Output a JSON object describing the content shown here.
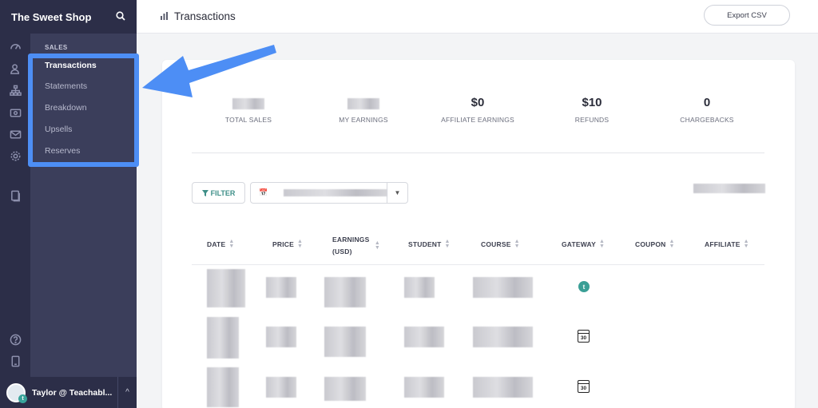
{
  "sidebar": {
    "brand": "The Sweet Shop",
    "section_label": "SALES",
    "items": [
      {
        "label": "Transactions",
        "active": true
      },
      {
        "label": "Statements",
        "active": false
      },
      {
        "label": "Breakdown",
        "active": false
      },
      {
        "label": "Upsells",
        "active": false
      },
      {
        "label": "Reserves",
        "active": false
      }
    ],
    "rail_icons": [
      "dashboard-icon",
      "users-icon",
      "sitemap-icon",
      "sales-icon",
      "email-icon",
      "settings-icon",
      "pages-icon",
      "help-icon",
      "mobile-icon"
    ],
    "user": {
      "name": "Taylor @ Teachabl...",
      "badge": "t"
    }
  },
  "header": {
    "title": "Transactions",
    "export_label": "Export CSV"
  },
  "stats": [
    {
      "value": "",
      "label": "TOTAL SALES",
      "blurred": true
    },
    {
      "value": "",
      "label": "MY EARNINGS",
      "blurred": true
    },
    {
      "value": "$0",
      "label": "AFFILIATE EARNINGS",
      "blurred": false
    },
    {
      "value": "$10",
      "label": "REFUNDS",
      "blurred": false
    },
    {
      "value": "0",
      "label": "CHARGEBACKS",
      "blurred": false
    }
  ],
  "toolbar": {
    "filter_label": "FILTER"
  },
  "table": {
    "columns": [
      "DATE",
      "PRICE",
      "EARNINGS (USD)",
      "STUDENT",
      "COURSE",
      "GATEWAY",
      "COUPON",
      "AFFILIATE"
    ],
    "rows": [
      {
        "gateway": "teachable",
        "gateway_text": "t"
      },
      {
        "gateway": "calendar",
        "gateway_text": "30"
      },
      {
        "gateway": "calendar",
        "gateway_text": "30"
      }
    ]
  },
  "colors": {
    "sidebar": "#3b3e5b",
    "sidebar_dark": "#2c2e48",
    "highlight": "#4d8ef5",
    "accent": "#3a9f96"
  }
}
